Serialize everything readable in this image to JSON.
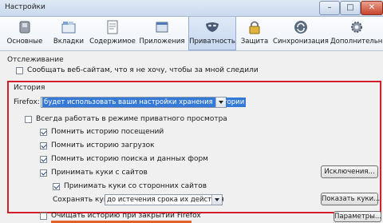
{
  "window": {
    "title": "Настройки",
    "minimize": "–",
    "maximize": "□",
    "close": "✕"
  },
  "tabs": [
    {
      "label": "Основные",
      "icon": "switch-icon"
    },
    {
      "label": "Вкладки",
      "icon": "tabs-icon"
    },
    {
      "label": "Содержимое",
      "icon": "document-icon"
    },
    {
      "label": "Приложения",
      "icon": "apps-icon"
    },
    {
      "label": "Приватность",
      "icon": "mask-icon",
      "active": true
    },
    {
      "label": "Защита",
      "icon": "lock-icon"
    },
    {
      "label": "Синхронизация",
      "icon": "sync-icon"
    },
    {
      "label": "Дополнительные",
      "icon": "gear-icon"
    }
  ],
  "tracking": {
    "heading": "Отслеживание",
    "dnt_label": "Сообщать веб-сайтам, что я не хочу, чтобы за мной следили",
    "dnt_checked": false
  },
  "history": {
    "heading": "История",
    "firefox_label": "Firefox:",
    "mode_value": "будет использовать ваши настройки хранения истории",
    "private_label": "Всегда работать в режиме приватного просмотра",
    "private_checked": false,
    "options": [
      {
        "label": "Помнить историю посещений",
        "checked": true
      },
      {
        "label": "Помнить историю загрузок",
        "checked": true
      },
      {
        "label": "Помнить историю поиска и данных форм",
        "checked": true
      },
      {
        "label": "Принимать куки с сайтов",
        "checked": true
      }
    ],
    "exceptions_button": "Исключения...",
    "third_party_label": "Принимать куки со сторонних сайтов",
    "third_party_checked": true,
    "keep_label": "Сохранять куки:",
    "keep_value": "до истечения срока их действия",
    "show_cookies_button": "Показать куки...",
    "clear_label": "Очищать историю при закрытии Firefox",
    "clear_checked": false,
    "params_button": "Параметры..."
  },
  "colors": {
    "highlight": "#d2202a",
    "accent": "#e0622a",
    "selection": "#3478d8"
  }
}
